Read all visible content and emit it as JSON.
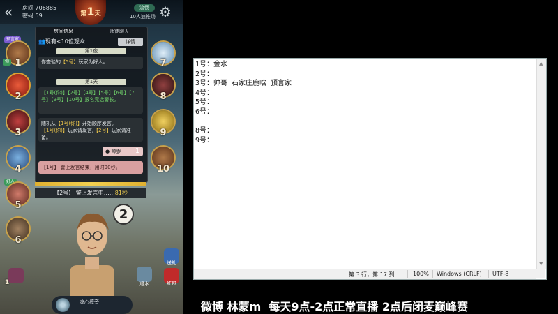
{
  "game": {
    "room_label": "房间 706885",
    "password_label": "密码 59",
    "day_prefix": "第",
    "day_number": "1",
    "day_suffix": "天",
    "flow_label": "流畅",
    "recommend_label": "10人速推场",
    "tabs": [
      "房间信息",
      "师徒聊天"
    ],
    "audience": "现有<10位观众",
    "detail_button": "详情",
    "night_separator": "第1夜",
    "day_separator": "第1天",
    "msg_check": {
      "pre": "你查验的",
      "who": "【5号】",
      "post": "玩家为好人。"
    },
    "msg_sheriff": "【1号(你)】【2号】【4号】【5号】【6号】【7号】【9号】【10号】报名竞选警长。",
    "msg_order": {
      "pre": "随机从",
      "who1": "【1号(你)】",
      "mid": "开始顺序发言。",
      "who2": "【1号(你)】",
      "mid2": "玩家请发言,",
      "who3": "【2号】",
      "post": "玩家请准备。"
    },
    "shuaige_label": "帅爹",
    "shuaige_count": "1",
    "red_msg": "【1号】 警上发言结束，用时90秒。",
    "speaking_prefix": "【2号】 警上发言中……",
    "speaking_seconds": "81秒",
    "speaking_player_number": "2",
    "left_players": [
      "1",
      "2",
      "3",
      "4",
      "5",
      "6"
    ],
    "right_players": [
      "7",
      "8",
      "9",
      "10"
    ],
    "seer_tag": "预言家",
    "you_tag": "你",
    "good_tag": "好人",
    "mic_label": "凉心缠旁",
    "btn_send": "送礼",
    "btn_water": "退水",
    "btn_redpacket": "红包",
    "bottom_left_count": "1"
  },
  "notepad": {
    "lines": [
      "1号：金水",
      "2号：",
      "3号：帅哥 石家庄鹿晗 预言家",
      "4号：",
      "5号：",
      "6号：",
      "",
      "8号：",
      "9号："
    ],
    "status_position": "第 3 行，第 17 列",
    "status_zoom": "100%",
    "status_eol": "Windows (CRLF)",
    "status_encoding": "UTF-8"
  },
  "caption": "微博 林蒙m  每天9点-2点正常直播 2点后闭麦巅峰赛",
  "colors": {
    "accent_gold": "#c9a24a",
    "highlight_yellow": "#f2d050",
    "good_green": "#6fd06a"
  }
}
